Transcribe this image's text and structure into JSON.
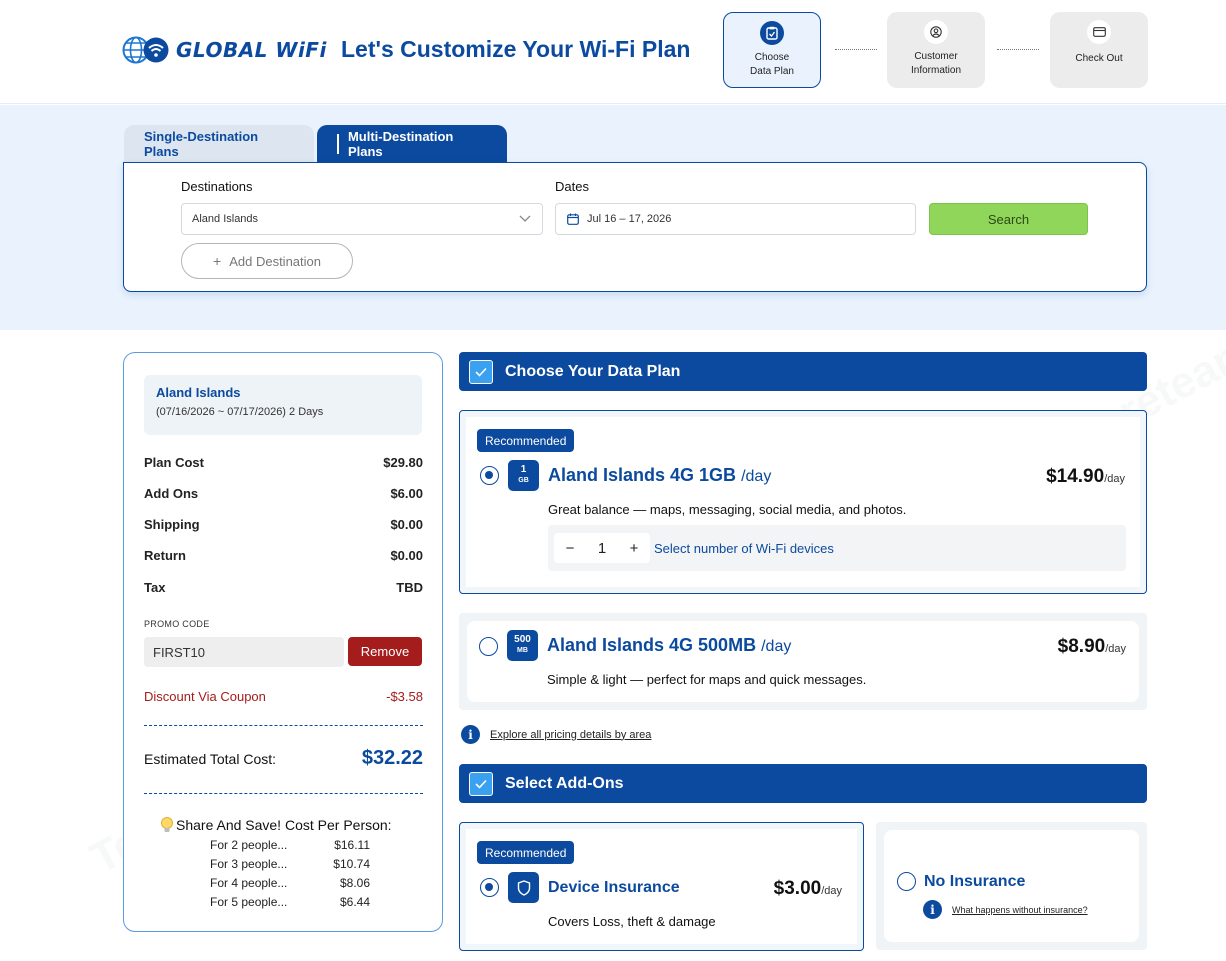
{
  "header": {
    "logo_text": "GLOBAL WiFi",
    "title": "Let's Customize Your Wi-Fi Plan",
    "steps": [
      {
        "line1": "Choose",
        "line2": "Data Plan",
        "icon": "clipboard-icon",
        "active": true
      },
      {
        "line1": "Customer",
        "line2": "Information",
        "icon": "user-icon",
        "active": false
      },
      {
        "line1": "Check Out",
        "line2": "",
        "icon": "card-icon",
        "active": false
      }
    ]
  },
  "tabs": {
    "single": "Single-Destination Plans",
    "multi": "Multi-Destination Plans",
    "active": "multi"
  },
  "search": {
    "destinations_label": "Destinations",
    "destination_value": "Aland Islands",
    "dates_label": "Dates",
    "dates_value": "Jul 16 – 17, 2026",
    "search_button": "Search",
    "add_destination": "Add Destination"
  },
  "summary": {
    "destination": "Aland Islands",
    "dates": "(07/16/2026 ~ 07/17/2026) 2 Days",
    "rows": [
      {
        "label": "Plan Cost",
        "value": "$29.80"
      },
      {
        "label": "Add Ons",
        "value": "$6.00"
      },
      {
        "label": "Shipping",
        "value": "$0.00"
      },
      {
        "label": "Return",
        "value": "$0.00"
      },
      {
        "label": "Tax",
        "value": "TBD"
      }
    ],
    "promo_label": "PROMO CODE",
    "promo_value": "FIRST10",
    "remove_button": "Remove",
    "discount_label": "Discount Via Coupon",
    "discount_value": "-$3.58",
    "total_label": "Estimated Total Cost:",
    "total_value": "$32.22",
    "share_title": "Share And Save! Cost Per Person:",
    "share_rows": [
      {
        "label": "For 2 people...",
        "value": "$16.11"
      },
      {
        "label": "For 3 people...",
        "value": "$10.74"
      },
      {
        "label": "For 4 people...",
        "value": "$8.06"
      },
      {
        "label": "For 5 people...",
        "value": "$6.44"
      }
    ]
  },
  "data_plan": {
    "section_title": "Choose Your Data Plan",
    "plans": [
      {
        "recommended": "Recommended",
        "badge_num": "1",
        "badge_unit": "GB",
        "name": "Aland Islands 4G 1GB",
        "per": "/day",
        "price": "$14.90",
        "price_per": "/day",
        "desc": "Great balance — maps, messaging, social media, and photos.",
        "quantity": "1",
        "quantity_note": "Select number of Wi-Fi devices",
        "selected": true
      },
      {
        "badge_num": "500",
        "badge_unit": "MB",
        "name": "Aland Islands 4G 500MB",
        "per": "/day",
        "price": "$8.90",
        "price_per": "/day",
        "desc": "Simple & light — perfect for maps and quick messages.",
        "selected": false
      }
    ],
    "pricing_link": "Explore all pricing details by area"
  },
  "addons": {
    "section_title": "Select Add-Ons",
    "insurance": {
      "recommended": "Recommended",
      "name": "Device Insurance",
      "price": "$3.00",
      "price_per": "/day",
      "desc": "Covers Loss, theft & damage",
      "selected": true
    },
    "no_insurance": {
      "name": "No Insurance",
      "link": "What happens without insurance?",
      "selected": false
    }
  },
  "watermark": "Tenereteam",
  "colors": {
    "brand": "#0b4a9e",
    "search_button": "#8fd65a",
    "remove": "#a51c1c",
    "accent_check": "#3aa0f0"
  }
}
